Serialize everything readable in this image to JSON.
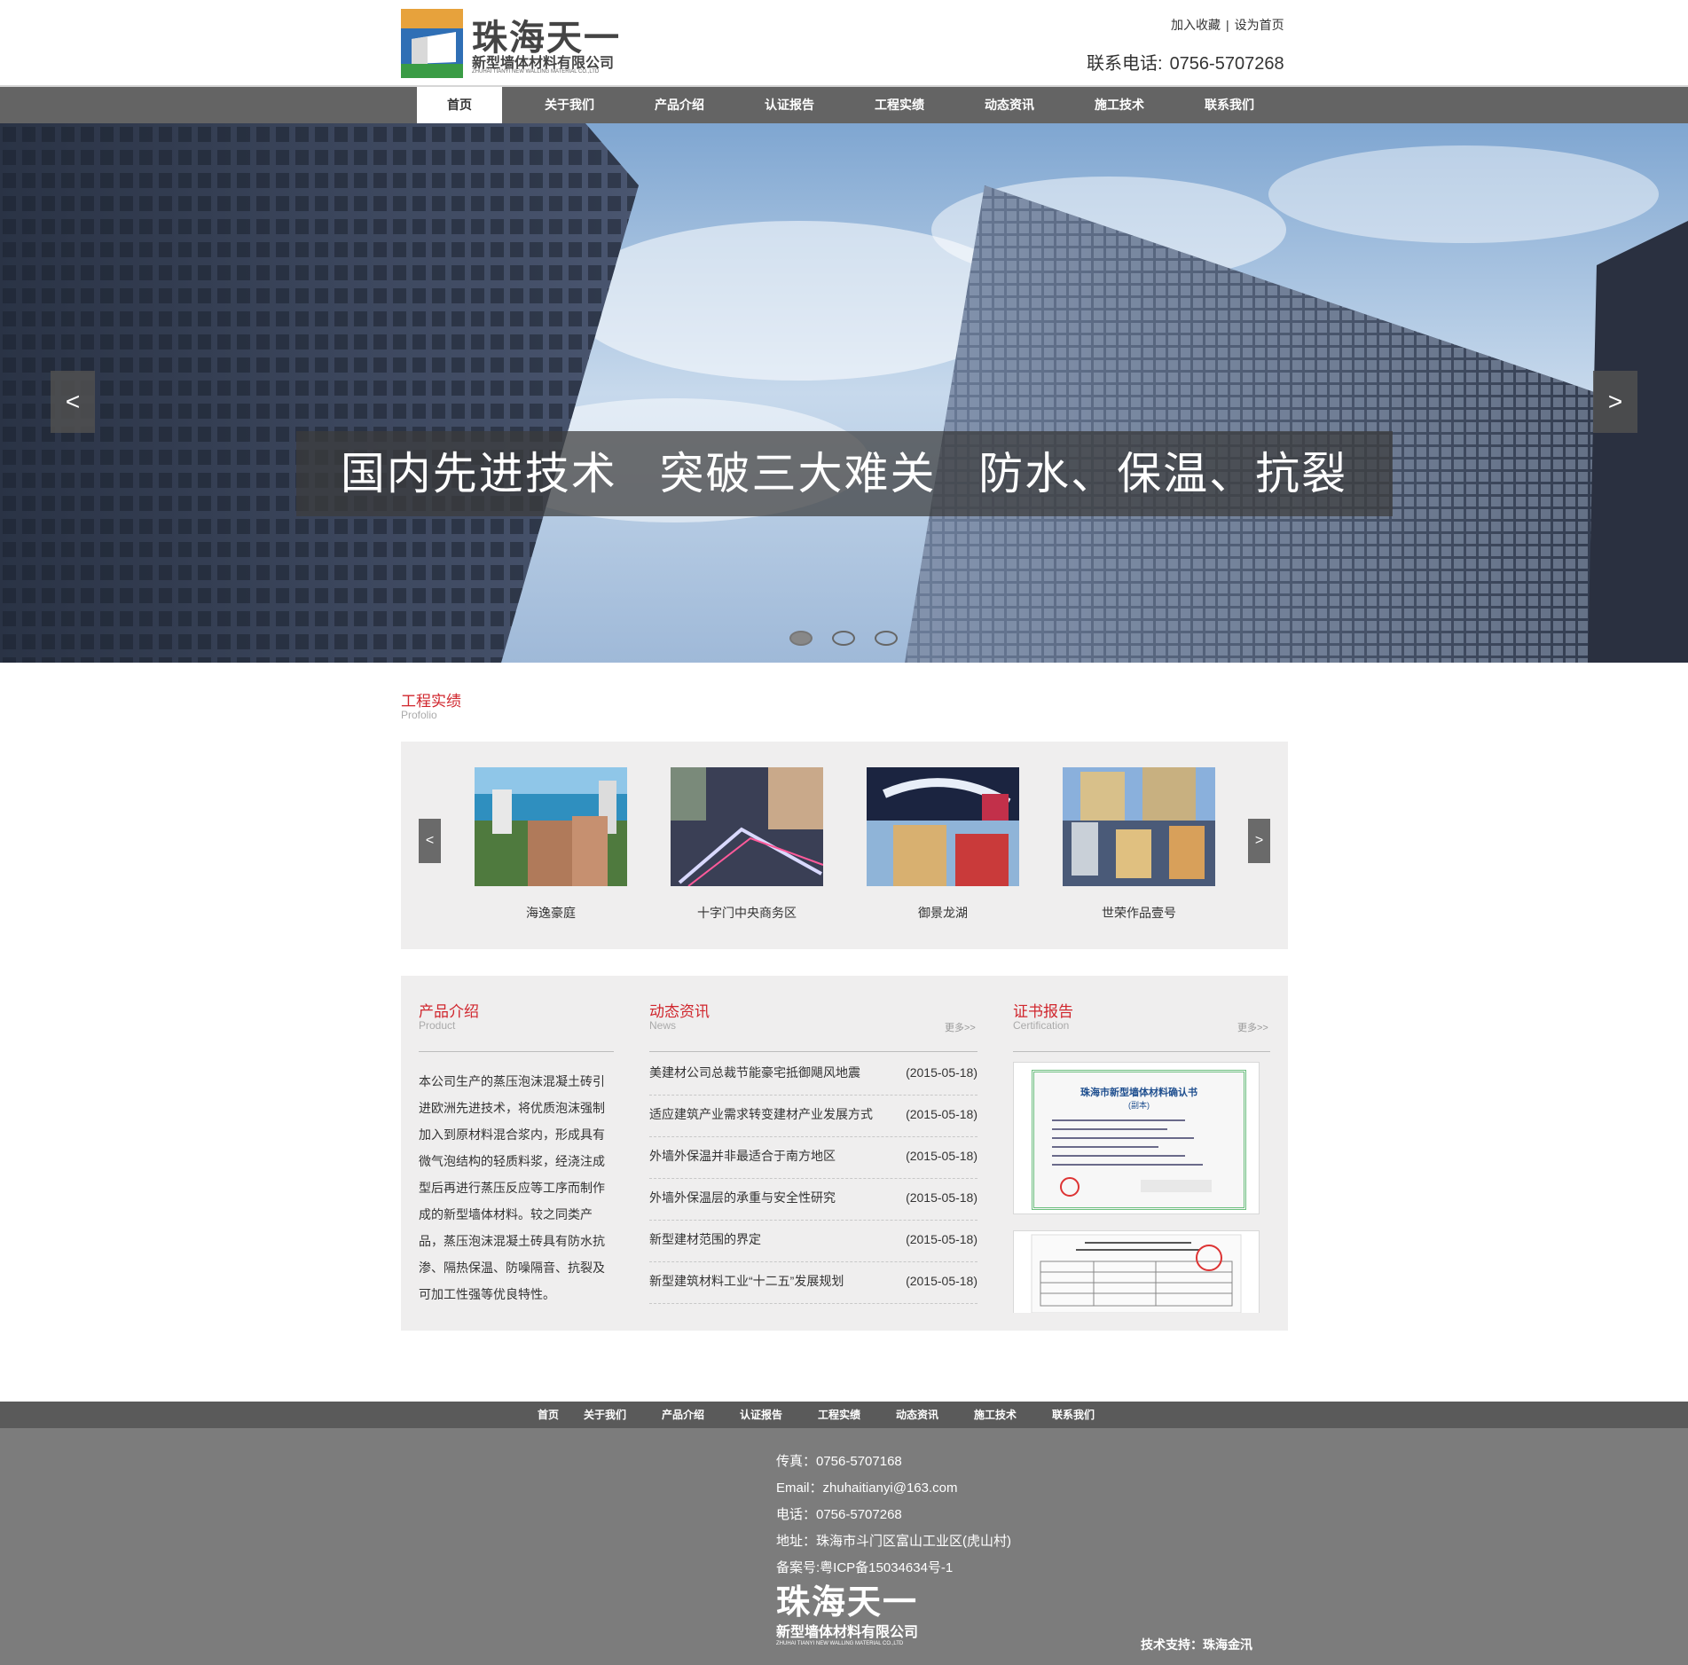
{
  "header": {
    "logo": {
      "name_cn": "珠海天一",
      "subtitle_cn": "新型墙体材料有限公司",
      "subtitle_en": "ZHUHAI TIANYI NEW WALLING MATERIAL CO.,LTD"
    },
    "top_links": {
      "bookmark": "加入收藏",
      "separator": "|",
      "homepage": "设为首页"
    },
    "phone_label": "联系电话:",
    "phone": "0756-5707268"
  },
  "nav": {
    "items": [
      "首页",
      "关于我们",
      "产品介绍",
      "认证报告",
      "工程实绩",
      "动态资讯",
      "施工技术",
      "联系我们"
    ],
    "active_index": 0
  },
  "banner": {
    "slogan": "国内先进技术   突破三大难关   防水、保温、抗裂",
    "prev_label": "<",
    "next_label": ">",
    "dots": 3,
    "active_dot": 0
  },
  "portfolio": {
    "title": "工程实绩",
    "subtitle": "Profolio",
    "prev_label": "<",
    "next_label": ">",
    "items": [
      {
        "caption": "海逸豪庭"
      },
      {
        "caption": "十字门中央商务区"
      },
      {
        "caption": "御景龙湖"
      },
      {
        "caption": "世荣作品壹号"
      }
    ]
  },
  "product": {
    "title": "产品介绍",
    "subtitle": "Product",
    "text": "本公司生产的蒸压泡沫混凝土砖引进欧洲先进技术，将优质泡沫强制加入到原材料混合浆内，形成具有微气泡结构的轻质料浆，经浇注成型后再进行蒸压反应等工序而制作成的新型墙体材料。较之同类产品，蒸压泡沫混凝土砖具有防水抗渗、隔热保温、防噪隔音、抗裂及可加工性强等优良特性。"
  },
  "news": {
    "title": "动态资讯",
    "subtitle": "News",
    "more": "更多>>",
    "items": [
      {
        "title": "美建材公司总裁节能豪宅抵御飓风地震",
        "date": "(2015-05-18)"
      },
      {
        "title": "适应建筑产业需求转变建材产业发展方式",
        "date": "(2015-05-18)"
      },
      {
        "title": "外墙外保温并非最适合于南方地区",
        "date": "(2015-05-18)"
      },
      {
        "title": "外墙外保温层的承重与安全性研究",
        "date": "(2015-05-18)"
      },
      {
        "title": "新型建材范围的界定",
        "date": "(2015-05-18)"
      },
      {
        "title": "新型建筑材料工业“十二五”发展规划",
        "date": "(2015-05-18)"
      }
    ]
  },
  "certificates": {
    "title": "证书报告",
    "subtitle": "Certification",
    "more": "更多>>",
    "cert1_heading": "珠海市新型墙体材料确认书",
    "cert1_sub": "(副本)"
  },
  "footer": {
    "nav": [
      "首页",
      "关于我们",
      "产品介绍",
      "认证报告",
      "工程实绩",
      "动态资讯",
      "施工技术",
      "联系我们"
    ],
    "fax": "传真：0756-5707168",
    "email": "Email：zhuhaitianyi@163.com",
    "tel": "电话：0756-5707268",
    "address": "地址：珠海市斗门区富山工业区(虎山村)",
    "icp": "备案号:粤ICP备15034634号-1",
    "logo_name": "珠海天一",
    "logo_sub": "新型墙体材料有限公司",
    "logo_en": "ZHUHAI TIANYI NEW WALLING MATERIAL CO.,LTD",
    "support": "技术支持：珠海金汛"
  },
  "colors": {
    "accent_red": "#d0262d",
    "nav_bg": "#646464",
    "footer_bg": "#7c7c7c",
    "panel_bg": "#efeeee"
  }
}
